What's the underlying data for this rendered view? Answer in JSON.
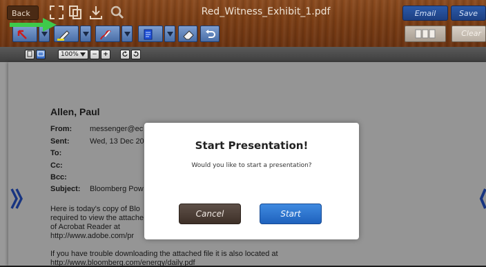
{
  "window": {
    "title": "Red_Witness_Exhibit_1.pdf"
  },
  "toolbar": {
    "back_label": "Back",
    "email_label": "Email",
    "save_label": "Save",
    "clear_label": "Clear"
  },
  "viewer": {
    "zoom": "100%",
    "zoom_out": "−",
    "zoom_in": "+"
  },
  "document": {
    "author": "Allen, Paul",
    "headers": [
      {
        "label": "From:",
        "value": "messenger@ec"
      },
      {
        "label": "Sent:",
        "value": "Wed, 13 Dec 20"
      },
      {
        "label": "To:",
        "value": ""
      },
      {
        "label": "Cc:",
        "value": ""
      },
      {
        "label": "Bcc:",
        "value": ""
      },
      {
        "label": "Subject:",
        "value": "Bloomberg Pow"
      }
    ],
    "body": [
      "Here is today's copy of Blo",
      "required to view the attache",
      "of Acrobat Reader at",
      "   http://www.adobe.com/pr",
      "If you have trouble downloading the attached file it is also located at",
      "   http://www.bloomberg.com/energy/daily.pdf"
    ]
  },
  "modal": {
    "title": "Start Presentation!",
    "message": "Would you like to start a presentation?",
    "cancel_label": "Cancel",
    "start_label": "Start"
  },
  "colors": {
    "wood": "#7a3d14",
    "blue_button": "#1f62bd",
    "cancel_button": "#4a3c34",
    "green_arrow": "#3ec94a",
    "nav_arrow": "#1b3a8c"
  }
}
